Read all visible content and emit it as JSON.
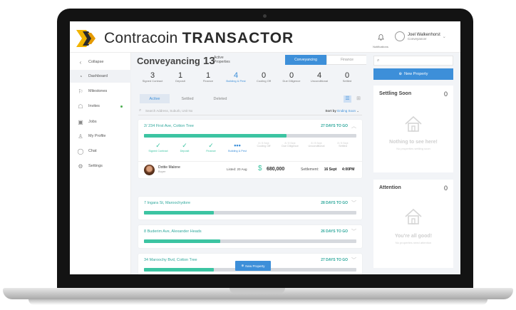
{
  "brand": {
    "name_light": "Contracoin",
    "name_bold": "TRANSACTOR",
    "colors": {
      "accent": "#3d8fd9",
      "progress": "#3cc4a2",
      "address": "#2fa89c"
    }
  },
  "header": {
    "notifications_label": "Notifications",
    "user_name": "Joel Walkenhorst",
    "user_role": "Conveyancer"
  },
  "sidebar": {
    "items": [
      {
        "label": "Collapse",
        "icon": "chevron-left-icon"
      },
      {
        "label": "Dashboard",
        "icon": "dashboard-icon",
        "active": true
      },
      {
        "label": "Milestones",
        "icon": "flag-icon"
      },
      {
        "label": "Invites",
        "icon": "invite-icon"
      },
      {
        "label": "Jobs",
        "icon": "briefcase-icon"
      },
      {
        "label": "My Profile",
        "icon": "user-icon"
      },
      {
        "label": "Chat",
        "icon": "chat-icon"
      },
      {
        "label": "Settings",
        "icon": "gear-icon"
      }
    ]
  },
  "main": {
    "title": "Conveyancing",
    "active_count": "13",
    "active_label_1": "Active",
    "active_label_2": "Properties",
    "toggle_on": "Conveyancing",
    "toggle_off": "Finance",
    "stats": [
      {
        "num": "3",
        "label": "Signed Contract"
      },
      {
        "num": "1",
        "label": "Deposit"
      },
      {
        "num": "1",
        "label": "Finance"
      },
      {
        "num": "4",
        "label": "Building & Pest",
        "active": true
      },
      {
        "num": "0",
        "label": "Cooling Off"
      },
      {
        "num": "0",
        "label": "Due Diligence"
      },
      {
        "num": "4",
        "label": "Unconditional"
      },
      {
        "num": "0",
        "label": "Settled"
      }
    ],
    "tabs": [
      "Active",
      "Settled",
      "Deleted"
    ],
    "search_placeholder": "Search Address, Suburb, Unit No",
    "sort_label": "Sort by",
    "sort_value": "Ending Soon",
    "new_property_label": "New Property"
  },
  "cards": [
    {
      "address": "2/ 234 First Ave, Cotton Tree",
      "days": "27 DAYS TO GO",
      "progress": 0.67,
      "expanded": true,
      "steps": [
        {
          "label": "Signed Contract",
          "state": "done"
        },
        {
          "label": "Deposit",
          "state": "done"
        },
        {
          "label": "Finance",
          "state": "done"
        },
        {
          "label": "Building & Pest",
          "state": "current"
        },
        {
          "label": "Cooling Off",
          "sub": "8 / 8 Sept",
          "state": "todo"
        },
        {
          "label": "Due Diligence",
          "sub": "8 / 8 Sept",
          "state": "todo"
        },
        {
          "label": "Unconditional",
          "sub": "8 / 8 Sept",
          "state": "todo"
        },
        {
          "label": "Settled",
          "sub": "8 / 8 Sept",
          "state": "todo"
        }
      ],
      "agent_name": "Dottie Malone",
      "agent_role": "Buyer",
      "listed": "Listed: 20 Aug",
      "price": "680,000",
      "settlement_label": "Settlement:",
      "settlement_date": "16 Sept",
      "settlement_time": "4:00PM"
    },
    {
      "address": "7 Ingara St, Maroochydore",
      "days": "28 DAYS TO GO",
      "progress": 0.33
    },
    {
      "address": "8 Buderim Ave, Alexander Heads",
      "days": "26 DAYS TO GO",
      "progress": 0.36
    },
    {
      "address": "34 Maroochy Bvd, Cotton Tree",
      "days": "27 DAYS TO GO",
      "progress": 0.33
    }
  ],
  "right_panel": {
    "new_property": "New Property",
    "settling": {
      "title": "Settling Soon",
      "count": "0",
      "empty_title": "Nothing to see here!",
      "empty_sub": "No properties settling soon"
    },
    "attention": {
      "title": "Attention",
      "count": "0",
      "empty_title": "You're all good!",
      "empty_sub": "No properties need attention"
    }
  }
}
